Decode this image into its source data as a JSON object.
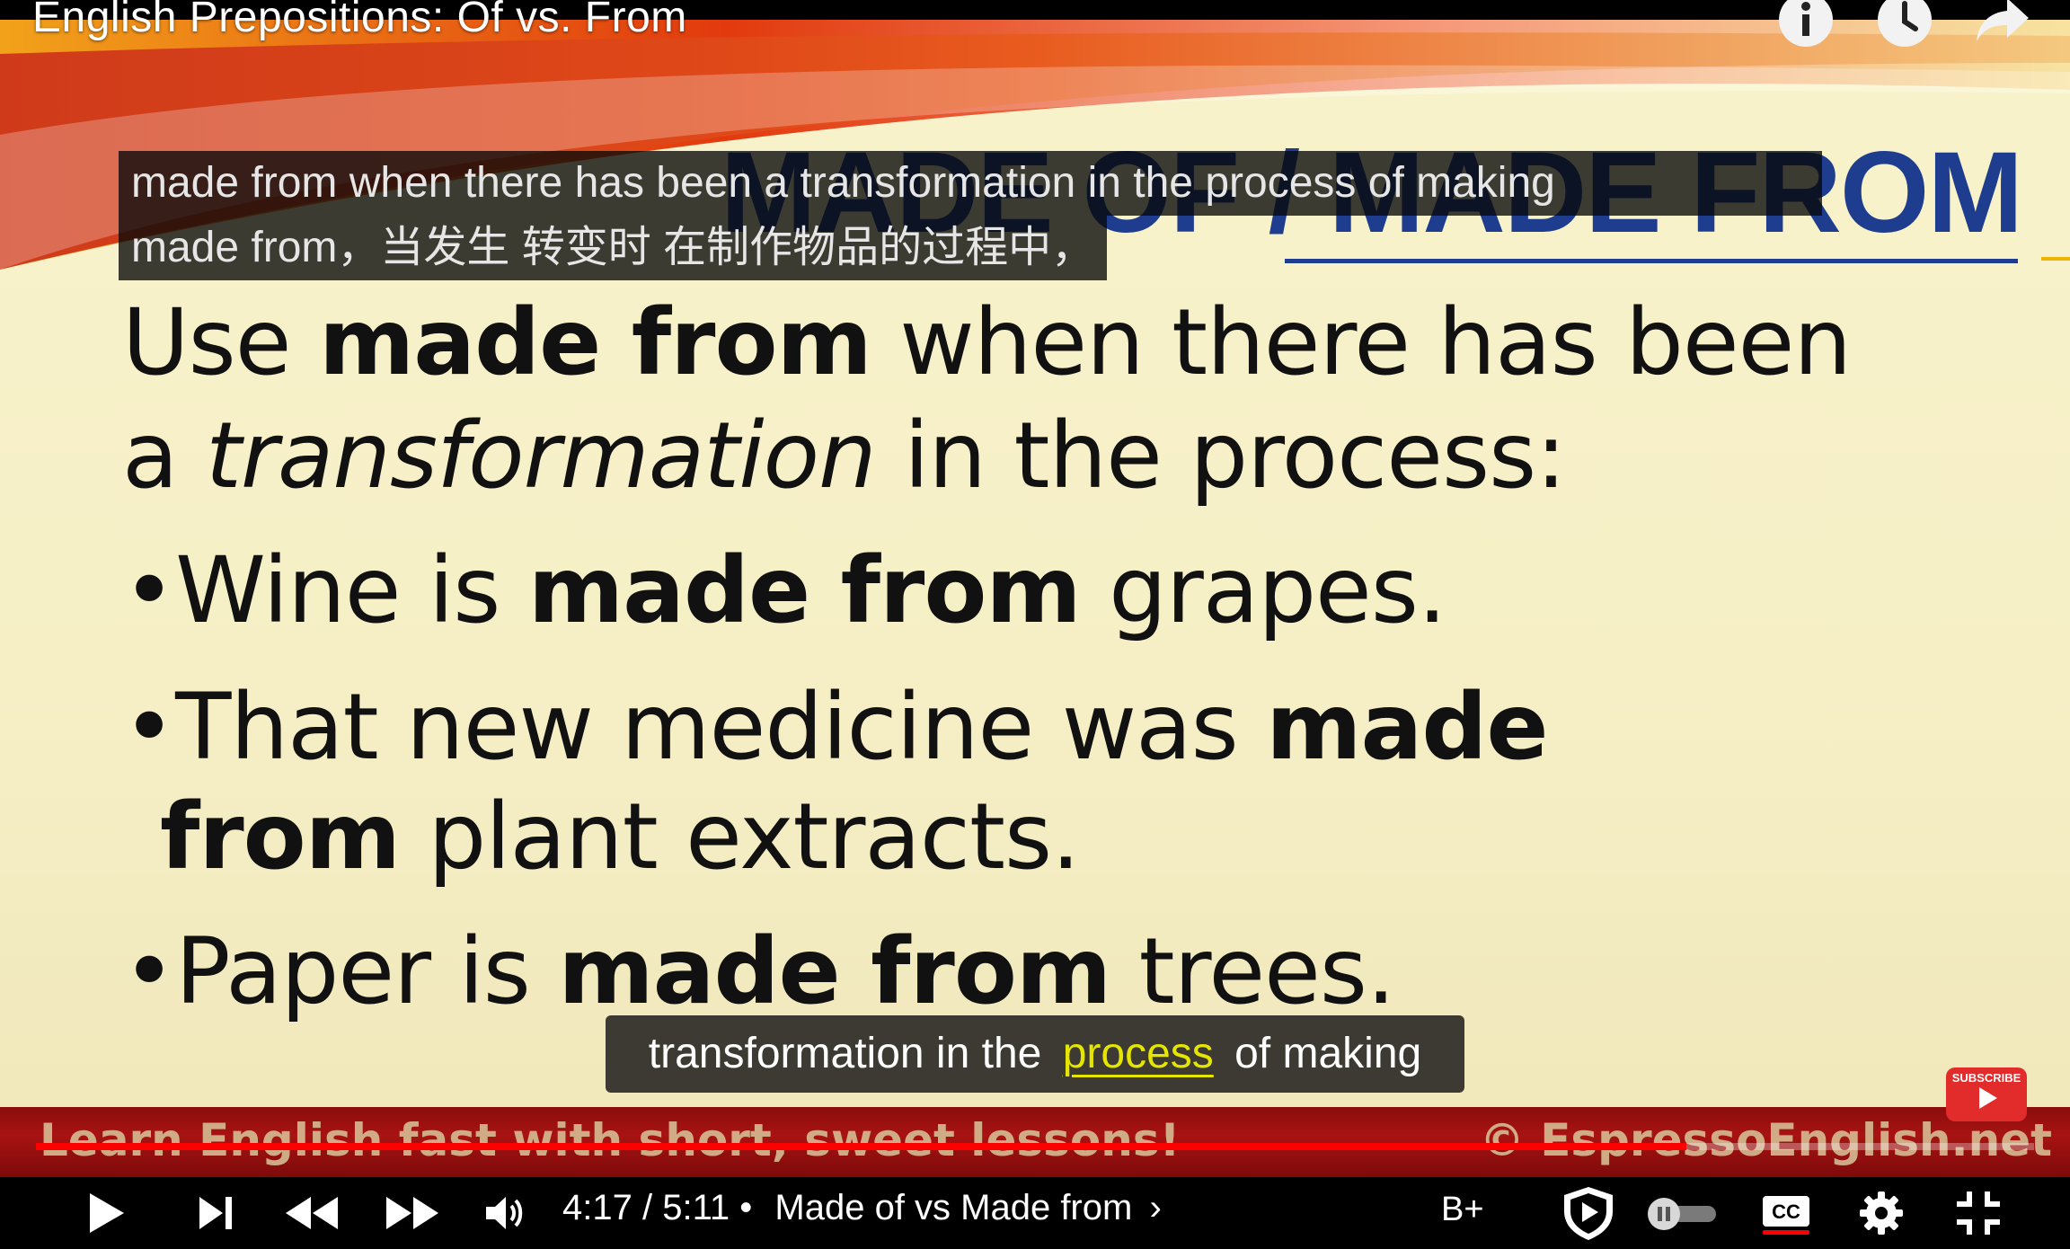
{
  "video": {
    "title": "English Prepositions: Of vs. From"
  },
  "slide": {
    "heading": "MADE OF / MADE FROM",
    "body": [
      [
        {
          "t": "Use "
        },
        {
          "t": "made from",
          "s": "b"
        },
        {
          "t": " when there has been"
        }
      ],
      [
        {
          "t": "a "
        },
        {
          "t": "transformation",
          "s": "i"
        },
        {
          "t": " in the process:"
        }
      ],
      [
        {
          "t": "•Wine is "
        },
        {
          "t": "made from",
          "s": "b"
        },
        {
          "t": " grapes."
        }
      ],
      [
        {
          "t": "•That new medicine was "
        },
        {
          "t": "made",
          "s": "b"
        }
      ],
      [
        {
          "t": "from",
          "s": "b"
        },
        {
          "t": " plant extracts."
        }
      ],
      [
        {
          "t": "•Paper is "
        },
        {
          "t": "made from",
          "s": "b"
        },
        {
          "t": " trees."
        }
      ]
    ],
    "banner_left": "Learn English fast with short, sweet lessons!",
    "banner_right": "© EspressoEnglish.net"
  },
  "overlay_caption": {
    "line1": "made from when there has been a transformation in the process of making",
    "line2": "made from，当发生 转变时 在制作物品的过程中，"
  },
  "bottom_caption": {
    "before": "transformation in the",
    "highlight": "process",
    "after": "of making",
    "highlight_color": "#e5e500"
  },
  "watermark": {
    "label": "SUBSCRIBE"
  },
  "player": {
    "current_time": "4:17",
    "separator": "/",
    "duration": "5:11",
    "chapter_bullet": "•",
    "chapter_title": "Made of vs Made from",
    "chapter_chevron": "›",
    "quality_badge": "B+",
    "progress_fraction": 0.826,
    "accent_color": "#ff0000"
  },
  "icons": {
    "top": [
      "info-icon",
      "watch-later-icon",
      "share-icon"
    ],
    "controls": [
      "play-icon",
      "next-icon",
      "rewind-icon",
      "fast-forward-icon",
      "volume-icon",
      "shield-play-icon",
      "autoplay-toggle-icon",
      "captions-icon",
      "settings-icon",
      "exit-fullscreen-icon"
    ]
  }
}
